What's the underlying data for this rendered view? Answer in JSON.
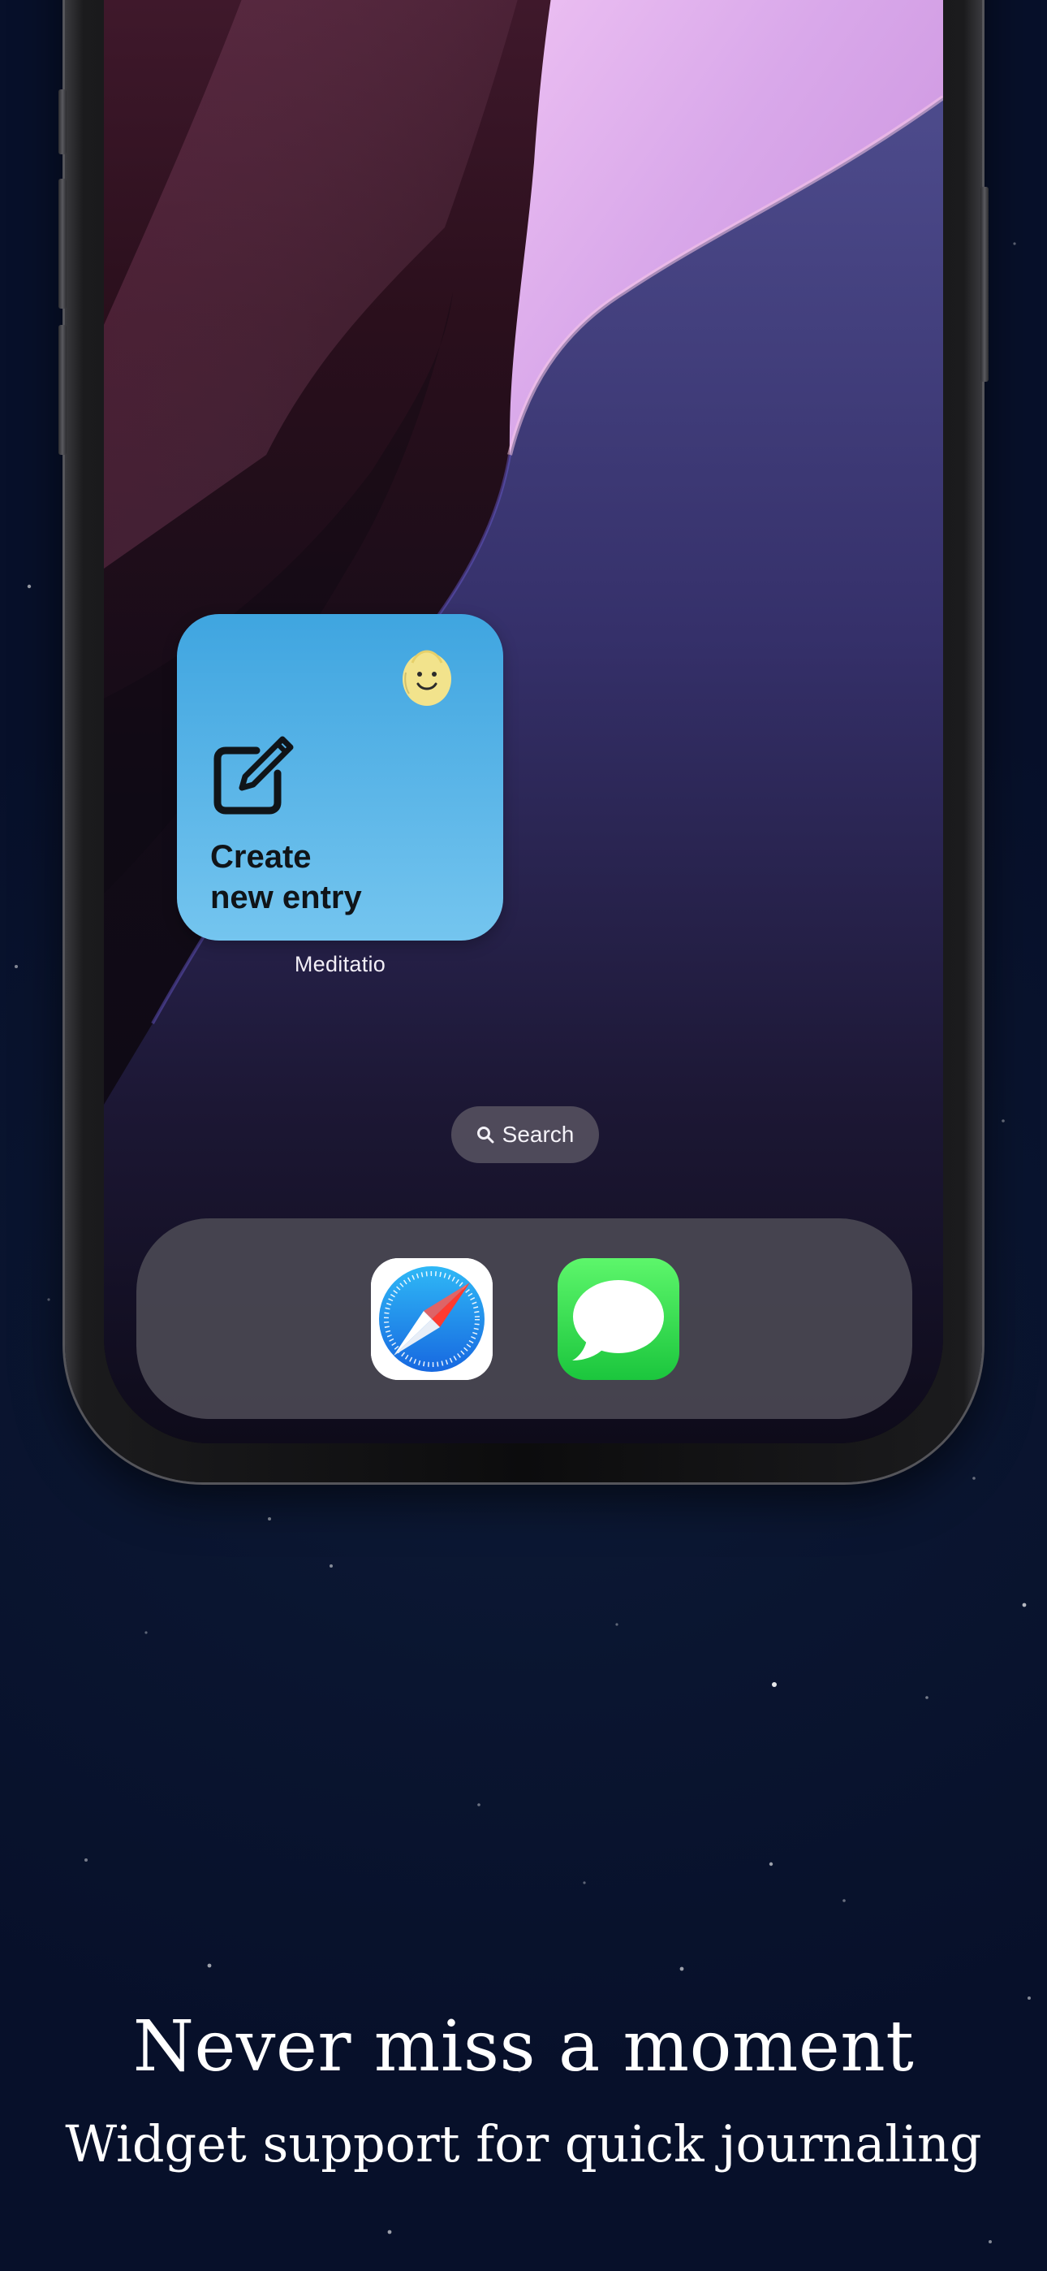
{
  "widget": {
    "title": "Create\nnew entry",
    "app_label": "Meditatio",
    "icon": "compose-icon",
    "mascot_icon": "smiling-face-mascot-icon"
  },
  "search": {
    "label": "Search",
    "icon": "search-icon"
  },
  "dock": {
    "apps": [
      {
        "name": "Safari",
        "icon": "safari-compass-icon"
      },
      {
        "name": "Messages",
        "icon": "messages-bubble-icon"
      }
    ]
  },
  "marketing": {
    "headline": "Never miss a moment",
    "subheadline": "Widget support for quick journaling"
  },
  "colors": {
    "background": "#0a1530",
    "widget": "#4aaee4",
    "widget_text": "#101418",
    "dock": "#4a4852",
    "messages_green": "#28cd41",
    "safari_blue": "#1e88e5"
  }
}
